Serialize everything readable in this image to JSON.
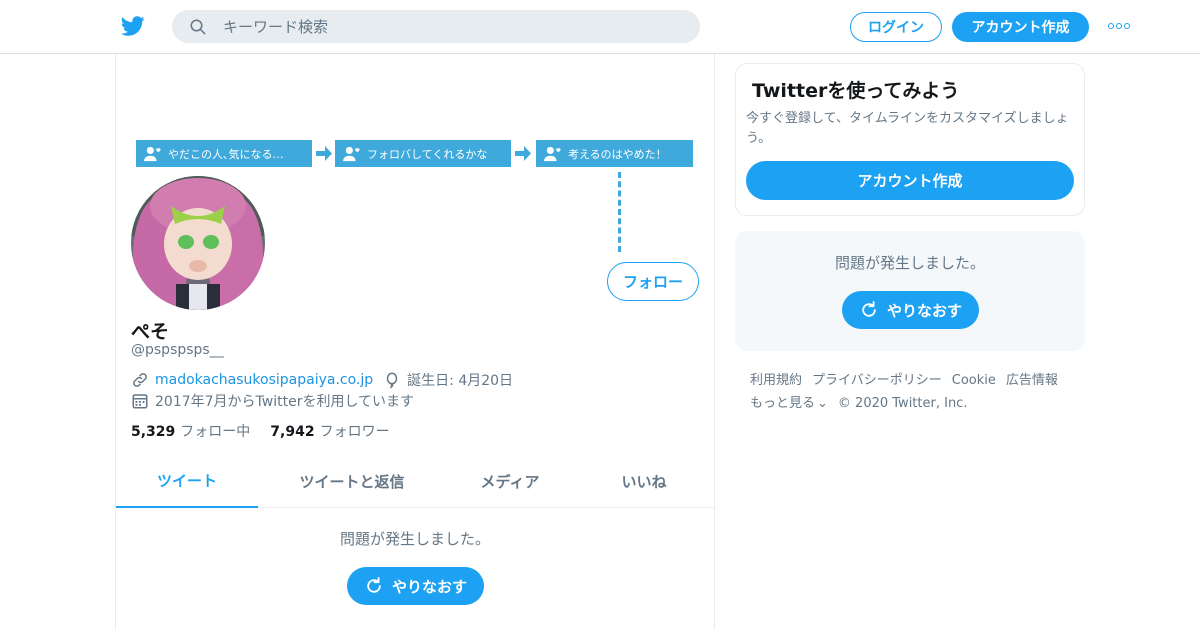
{
  "header": {
    "logo_icon": "twitter-bird-icon",
    "search_placeholder": "キーワード検索",
    "login_label": "ログイン",
    "signup_label": "アカウント作成",
    "more_icon": "more-dots-icon"
  },
  "banner": {
    "steps": [
      "やだこの人､気になる…",
      "フォロバしてくれるかな",
      "考えるのはやめた！"
    ]
  },
  "profile": {
    "name": "ぺそ",
    "handle": "@pspspsps__",
    "website": "madokachasukosipapaiya.co.jp",
    "birthday": "誕生日: 4月20日",
    "joined": "2017年7月からTwitterを利用しています",
    "following_count": "5,329",
    "following_label": "フォロー中",
    "followers_count": "7,942",
    "followers_label": "フォロワー",
    "follow_button": "フォロー"
  },
  "tabs": [
    {
      "label": "ツイート",
      "active": true
    },
    {
      "label": "ツイートと返信",
      "active": false
    },
    {
      "label": "メディア",
      "active": false
    },
    {
      "label": "いいね",
      "active": false
    }
  ],
  "timeline": {
    "error_message": "問題が発生しました。",
    "retry_label": "やりなおす"
  },
  "sidebar": {
    "signup_title": "Twitterを使ってみよう",
    "signup_text": "今すぐ登録して、タイムラインをカスタマイズしましょう。",
    "signup_button": "アカウント作成",
    "error_message": "問題が発生しました。",
    "retry_label": "やりなおす"
  },
  "footer": {
    "links": [
      "利用規約",
      "プライバシーポリシー",
      "Cookie",
      "広告情報"
    ],
    "more": "もっと見る",
    "copyright": "© 2020 Twitter, Inc."
  },
  "colors": {
    "accent": "#1da1f2",
    "secondary_text": "#657786",
    "banner_blue": "#3fa9dc"
  }
}
